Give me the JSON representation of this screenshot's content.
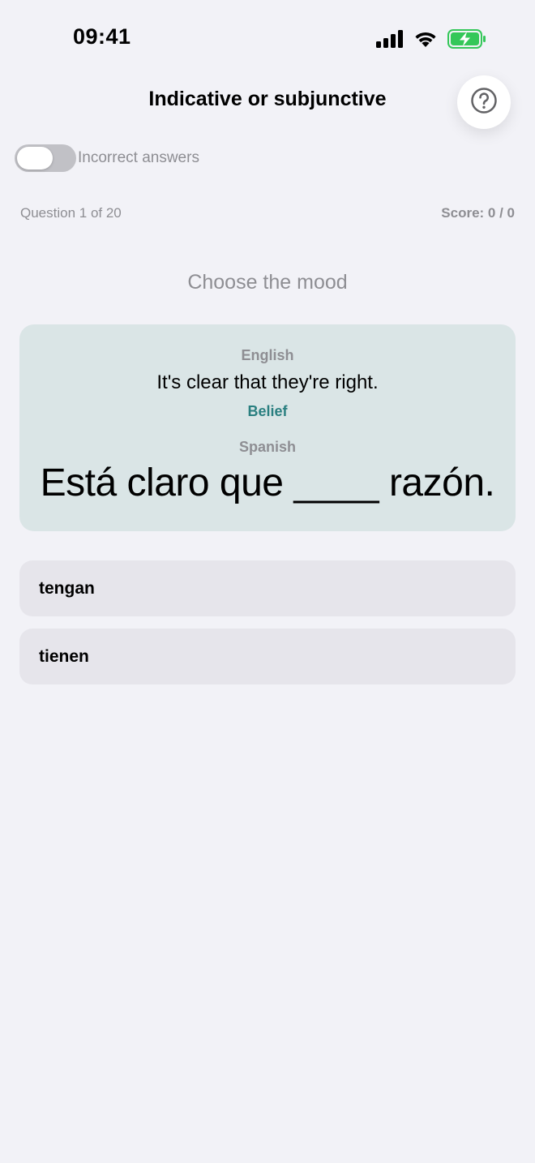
{
  "status_bar": {
    "time": "09:41",
    "icons": [
      "signal-icon",
      "wifi-icon",
      "battery-charging-icon"
    ],
    "battery_color": "#34c759"
  },
  "header": {
    "title": "Indicative or subjunctive",
    "help_icon": "question-mark-circle-icon"
  },
  "toggle": {
    "label": "Incorrect answers",
    "on": false
  },
  "progress": {
    "question": "Question 1 of 20",
    "score": "Score: 0 / 0"
  },
  "prompt": "Choose the mood",
  "card": {
    "english_label": "English",
    "english_sentence": "It's clear that they're right.",
    "category": "Belief",
    "spanish_label": "Spanish",
    "spanish_sentence": "Está claro que ____ razón.",
    "background": "#dae5e6",
    "accent": "#2a7f80"
  },
  "options": [
    {
      "label": "tengan"
    },
    {
      "label": "tienen"
    }
  ]
}
